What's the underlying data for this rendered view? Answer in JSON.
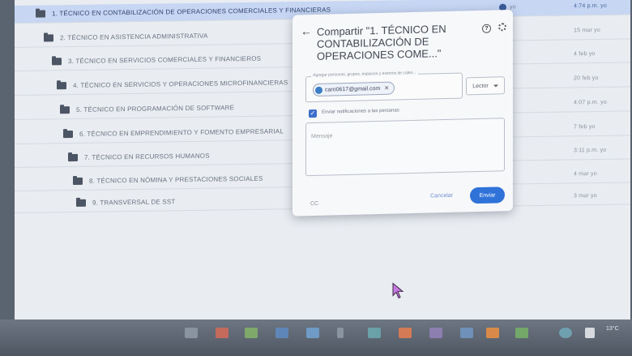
{
  "files": [
    {
      "name": "1. TÉCNICO EN CONTABILIZACIÓN DE OPERACIONES COMERCIALES Y FINANCIERAS",
      "owner": "yo",
      "modified": "4:74 p.m. yo",
      "selected": true
    },
    {
      "name": "2. TÉCNICO EN ASISTENCIA ADMINISTRATIVA",
      "owner": "yo",
      "modified": "15 mar yo"
    },
    {
      "name": "3. TÉCNICO EN SERVICIOS COMERCIALES Y FINANCIEROS",
      "owner": "yo",
      "modified": "4 feb yo"
    },
    {
      "name": "4. TÉCNICO EN SERVICIOS Y OPERACIONES MICROFINANCIERAS",
      "owner": "yo",
      "modified": "20 feb yo"
    },
    {
      "name": "5. TÉCNICO EN PROGRAMACIÓN DE SOFTWARE",
      "owner": "yo",
      "modified": "4:07 p.m. yo"
    },
    {
      "name": "6. TÉCNICO EN EMPRENDIMIENTO Y FOMENTO EMPRESARIAL",
      "owner": "yo",
      "modified": "7 feb yo"
    },
    {
      "name": "7. TÉCNICO EN RECURSOS HUMANOS",
      "owner": "yo",
      "modified": "3:11 p.m. yo"
    },
    {
      "name": "8. TÉCNICO EN NÓMINA Y PRESTACIONES SOCIALES",
      "owner": "yo",
      "modified": "4 mar yo"
    },
    {
      "name": "9. TRANSVERSAL DE SST",
      "owner": "yo",
      "modified": "3 mar yo"
    }
  ],
  "dialog": {
    "title": "Compartir \"1. TÉCNICO EN CONTABILIZACIÓN DE OPERACIONES COME...\"",
    "people_label": "Agregar personas, grupos, espacios y eventos de calen...",
    "chip_email": "caro0617@gmail.com",
    "role": "Lector",
    "notify_label": "Enviar notificaciones a las personas",
    "message_placeholder": "Mensaje",
    "cc": "CC",
    "cancel": "Cancelar",
    "send": "Enviar"
  },
  "taskbar": {
    "temperature": "13°C"
  },
  "colors": {
    "accent": "#2f73d9",
    "selected_row": "#c6d6f3",
    "folder": "#4c5564"
  }
}
